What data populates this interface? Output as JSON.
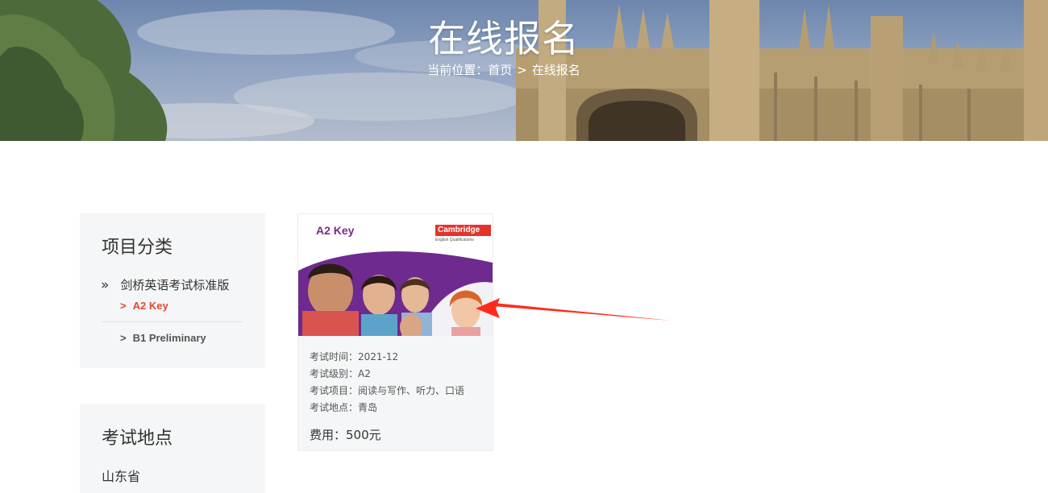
{
  "banner": {
    "title": "在线报名",
    "breadcrumb": {
      "prefix": "当前位置：",
      "home": "首页",
      "separator": ">",
      "current": "在线报名"
    }
  },
  "sidebar": {
    "category_panel": {
      "title": "项目分类",
      "parent": "剑桥英语考试标准版",
      "items": [
        {
          "label": "A2 Key",
          "active": true
        },
        {
          "label": "B1 Preliminary",
          "active": false
        }
      ]
    },
    "location_panel": {
      "title": "考试地点",
      "province": "山东省"
    }
  },
  "card": {
    "image_title": "A2 Key",
    "brand_tag": "Cambridge",
    "brand_sub": "English Qualifications",
    "info": [
      {
        "label": "考试时间：",
        "value": "2021-12"
      },
      {
        "label": "考试级别：",
        "value": "A2"
      },
      {
        "label": "考试项目：",
        "value": "阅读与写作、听力、口语"
      },
      {
        "label": "考试地点：",
        "value": "青岛"
      }
    ],
    "fee_label": "费用：",
    "fee_value": "500元"
  },
  "colors": {
    "accent": "#e04a32",
    "panel_bg": "#f5f6f7",
    "purple": "#6e2a8e",
    "arrow": "#ff2a1a"
  }
}
